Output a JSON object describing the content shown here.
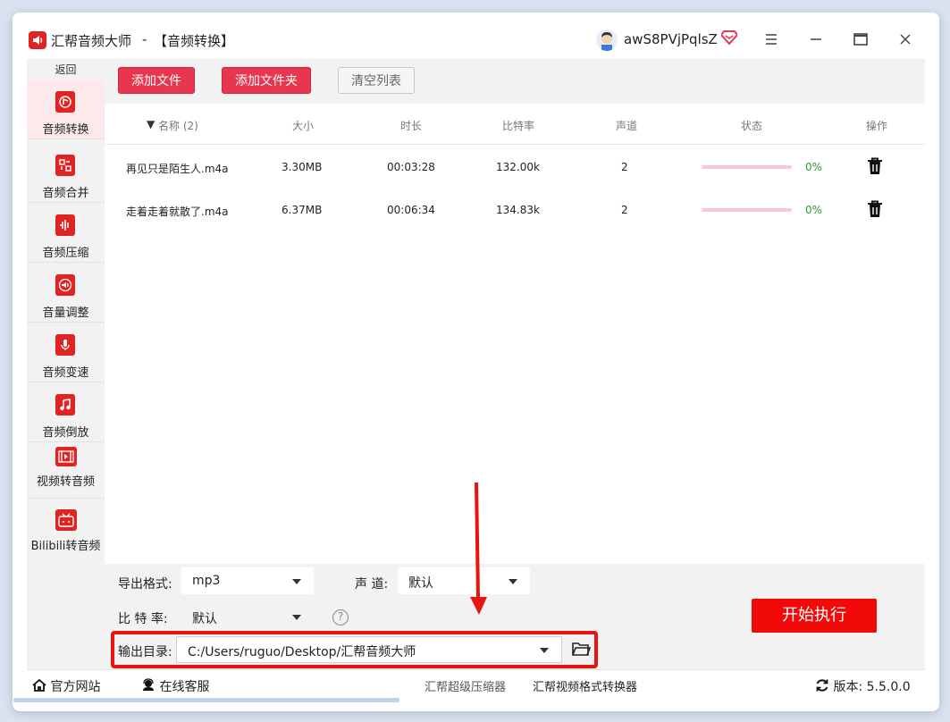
{
  "window": {
    "app_name": "汇帮音频大师",
    "separator": "-",
    "page_title": "【音频转换】",
    "username": "awS8PVjPqlsZ"
  },
  "sidebar": {
    "back_label": "返回",
    "items": [
      {
        "label": "音频转换",
        "icon": "audio-convert-icon",
        "active": true
      },
      {
        "label": "音频合并",
        "icon": "audio-merge-icon",
        "active": false
      },
      {
        "label": "音频压缩",
        "icon": "audio-compress-icon",
        "active": false
      },
      {
        "label": "音量调整",
        "icon": "volume-adjust-icon",
        "active": false
      },
      {
        "label": "音频变速",
        "icon": "audio-speed-icon",
        "active": false
      },
      {
        "label": "音频倒放",
        "icon": "audio-reverse-icon",
        "active": false
      },
      {
        "label": "视频转音频",
        "icon": "video-to-audio-icon",
        "active": false
      },
      {
        "label": "Bilibili转音频",
        "icon": "bilibili-icon",
        "active": false
      }
    ]
  },
  "toolbar": {
    "add_file": "添加文件",
    "add_folder": "添加文件夹",
    "clear_list": "清空列表"
  },
  "table": {
    "headers": {
      "name": "名称 (2)",
      "size": "大小",
      "duration": "时长",
      "bitrate": "比特率",
      "channels": "声道",
      "status": "状态",
      "action": "操作"
    },
    "rows": [
      {
        "name": "再见只是陌生人.m4a",
        "size": "3.30MB",
        "duration": "00:03:28",
        "bitrate": "132.00k",
        "channels": "2",
        "progress": 0,
        "pct": "0%"
      },
      {
        "name": "走着走着就散了.m4a",
        "size": "6.37MB",
        "duration": "00:06:34",
        "bitrate": "134.83k",
        "channels": "2",
        "progress": 0,
        "pct": "0%"
      }
    ]
  },
  "settings": {
    "format_label": "导出格式:",
    "format_value": "mp3",
    "channel_label": "声 道:",
    "channel_value": "默认",
    "bitrate_label": "比 特 率:",
    "bitrate_value": "默认",
    "help": "?",
    "outdir_label": "输出目录:",
    "outdir_value": "C:/Users/ruguo/Desktop/汇帮音频大师",
    "start_button": "开始执行"
  },
  "footer": {
    "website": "官方网站",
    "support": "在线客服",
    "link1": "汇帮超级压缩器",
    "link2": "汇帮视频格式转换器",
    "version_label": "版本:",
    "version_value": "5.5.0.0"
  },
  "colors": {
    "accent": "#e8364f",
    "start": "#f20a0a",
    "highlight": "#e8140f",
    "progress_ok": "#2e9a3a"
  }
}
